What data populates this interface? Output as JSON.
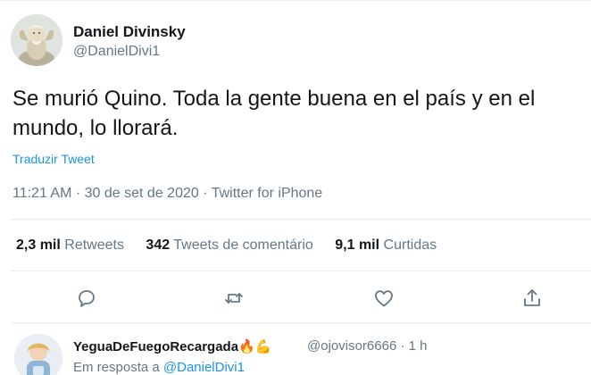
{
  "author": {
    "name": "Daniel Divinsky",
    "handle": "@DanielDivi1"
  },
  "tweet": {
    "text": "Se murió Quino. Toda la gente buena en el país y en el mundo, lo llorará.",
    "translate_label": "Traduzir Tweet",
    "time": "11:21 AM",
    "date": "30 de set de 2020",
    "separator": "·",
    "source": "Twitter for iPhone"
  },
  "stats": [
    {
      "value": "2,3 mil",
      "label": "Retweets"
    },
    {
      "value": "342",
      "label": "Tweets de comentário"
    },
    {
      "value": "9,1 mil",
      "label": "Curtidas"
    }
  ],
  "actions": {
    "reply_icon": "reply-icon",
    "retweet_icon": "retweet-icon",
    "like_icon": "like-icon",
    "share_icon": "share-icon",
    "icon_color": "#657786"
  },
  "reply": {
    "name": "YeguaDeFuegoRecargada",
    "emojis": "🔥💪",
    "handle": "@ojovisor6666",
    "separator": "·",
    "time": "1 h",
    "in_reply_prefix": "Em resposta a",
    "in_reply_mention": "@DanielDivi1"
  },
  "colors": {
    "text": "#14171a",
    "secondary": "#657786",
    "link": "#1b95e0",
    "divider": "#e6ecf0"
  }
}
